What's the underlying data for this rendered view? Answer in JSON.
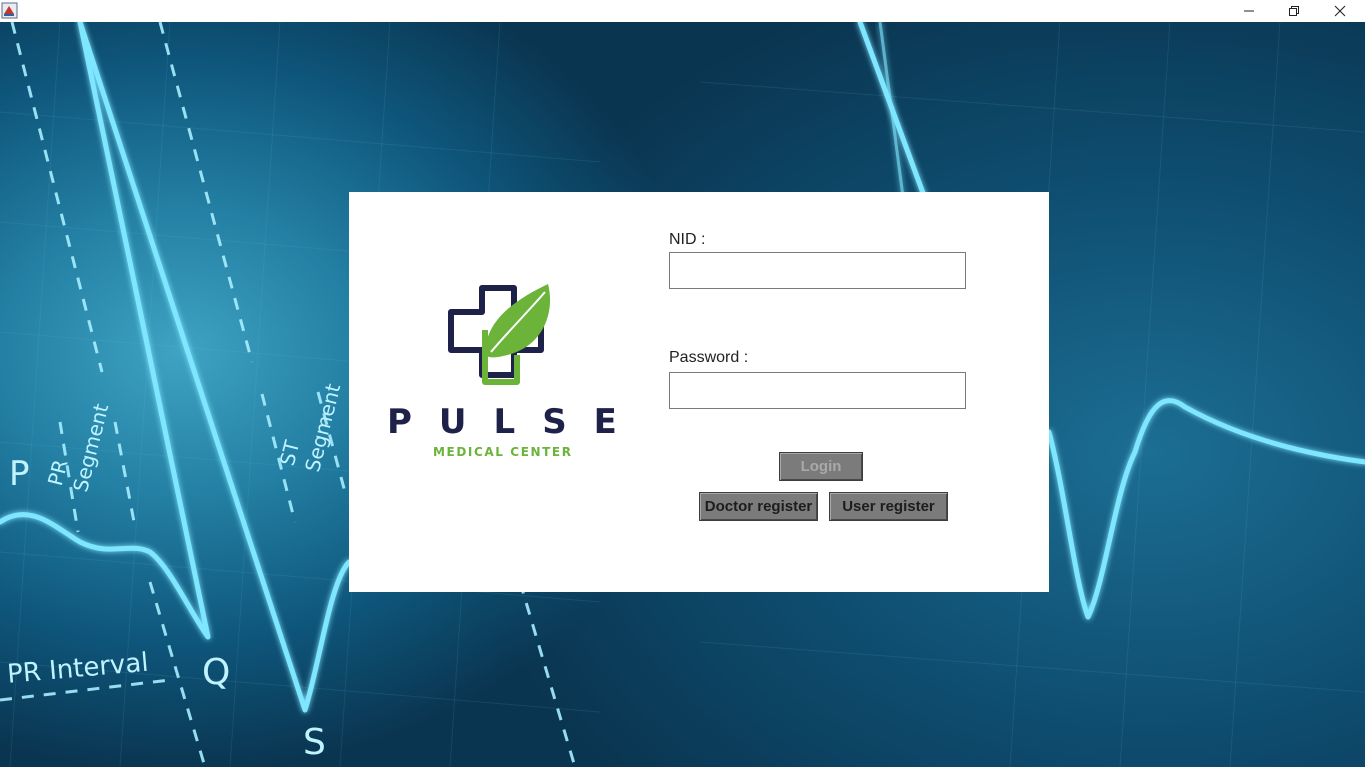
{
  "window": {
    "minimize_icon": "minimize-icon",
    "maximize_icon": "restore-icon",
    "close_icon": "close-icon"
  },
  "background": {
    "labels": {
      "p": "P",
      "q": "Q",
      "s": "S",
      "pr_segment": "PR Segment",
      "st_segment": "ST Segment",
      "pr_interval": "PR Interval"
    }
  },
  "brand": {
    "name": "PULSE",
    "subtitle": "MEDICAL CENTER",
    "colors": {
      "navy": "#1f2248",
      "green": "#6cb33a"
    }
  },
  "form": {
    "nid_label": "NID :",
    "nid_value": "",
    "password_label": "Password :",
    "password_value": "",
    "login_label": "Login",
    "doctor_register_label": "Doctor register",
    "user_register_label": "User register"
  }
}
